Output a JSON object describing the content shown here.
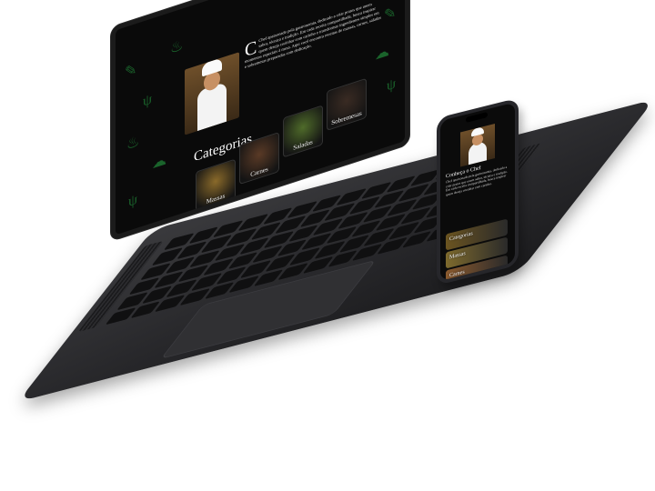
{
  "laptop": {
    "about": {
      "initial": "C",
      "body": "Chef apaixonado pela gastronomia, dedicado a criar pratos que unem sabor, técnica e tradição. Em cada receita compartilhada, busca inspirar quem deseja cozinhar com carinho e transformar ingredientes simples em momentos especiais à mesa. Aqui você encontra receitas de massas, carnes, saladas e sobremesas preparadas com dedicação."
    },
    "categories_title": "Categorias",
    "categories": [
      {
        "label": "Massas",
        "color": "#8a6a2a"
      },
      {
        "label": "Carnes",
        "color": "#5a3a26"
      },
      {
        "label": "Saladas",
        "color": "#4f6b2a"
      },
      {
        "label": "Sobremesas",
        "color": "#3a2b23"
      }
    ]
  },
  "phone": {
    "title": "Conheça o Chef",
    "body": "Chef apaixonado pela gastronomia, dedicado a criar pratos que unem sabor, técnica e tradição. Em cada receita compartilhada, busca inspirar quem deseja cozinhar com carinho.",
    "cards": [
      {
        "label": "Categorias",
        "color": "#6b5420"
      },
      {
        "label": "Massas",
        "color": "#7e6a2d"
      },
      {
        "label": "Carnes",
        "color": "#8b5a2e"
      }
    ]
  },
  "colors": {
    "accent_green": "#1f7a34",
    "screen_bg": "#0a0a0a"
  }
}
